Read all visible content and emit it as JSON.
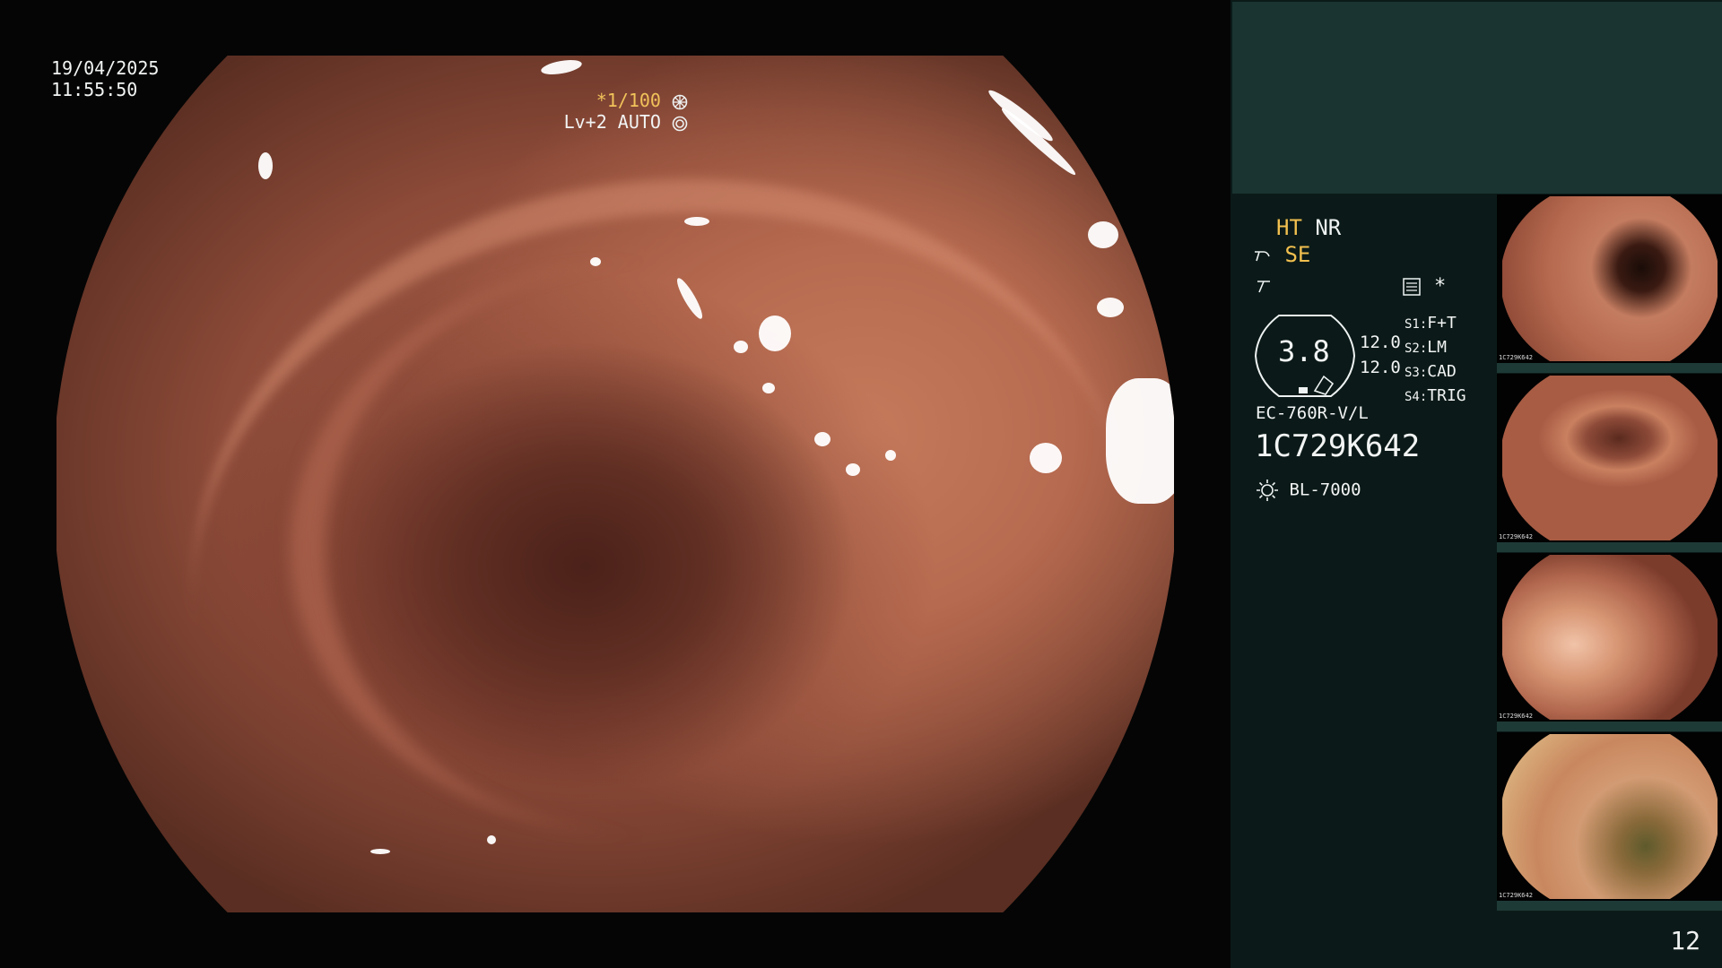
{
  "overlay": {
    "date": "19/04/2025",
    "time": "11:55:50",
    "shutter": "*1/100",
    "light_mode": "Lv+2 AUTO"
  },
  "panel": {
    "ht": "HT",
    "nr": "NR",
    "se": "SE",
    "star": "*",
    "zoom_value": "3.8",
    "param_a": "12.0",
    "param_b": "12.0",
    "switches": [
      {
        "key": "S1:",
        "value": "F+T"
      },
      {
        "key": "S2:",
        "value": "LM"
      },
      {
        "key": "S3:",
        "value": "CAD"
      },
      {
        "key": "S4:",
        "value": "TRIG"
      }
    ],
    "scope_model": "EC-760R-V/L",
    "serial": "1C729K642",
    "light_source": "BL-7000",
    "page_number": "12"
  },
  "thumbnails": [
    {
      "label": "1C729K642"
    },
    {
      "label": "1C729K642"
    },
    {
      "label": "1C729K642"
    },
    {
      "label": "1C729K642"
    }
  ],
  "colors": {
    "accent_yellow": "#f2c04f",
    "panel_bg": "#0b1a18",
    "panel_header": "#193431",
    "tissue": "#b66a4f"
  },
  "icons": [
    "shutter-icon",
    "iris-icon",
    "se-icon",
    "enhance-icon",
    "settings-icon",
    "lamp-icon"
  ]
}
